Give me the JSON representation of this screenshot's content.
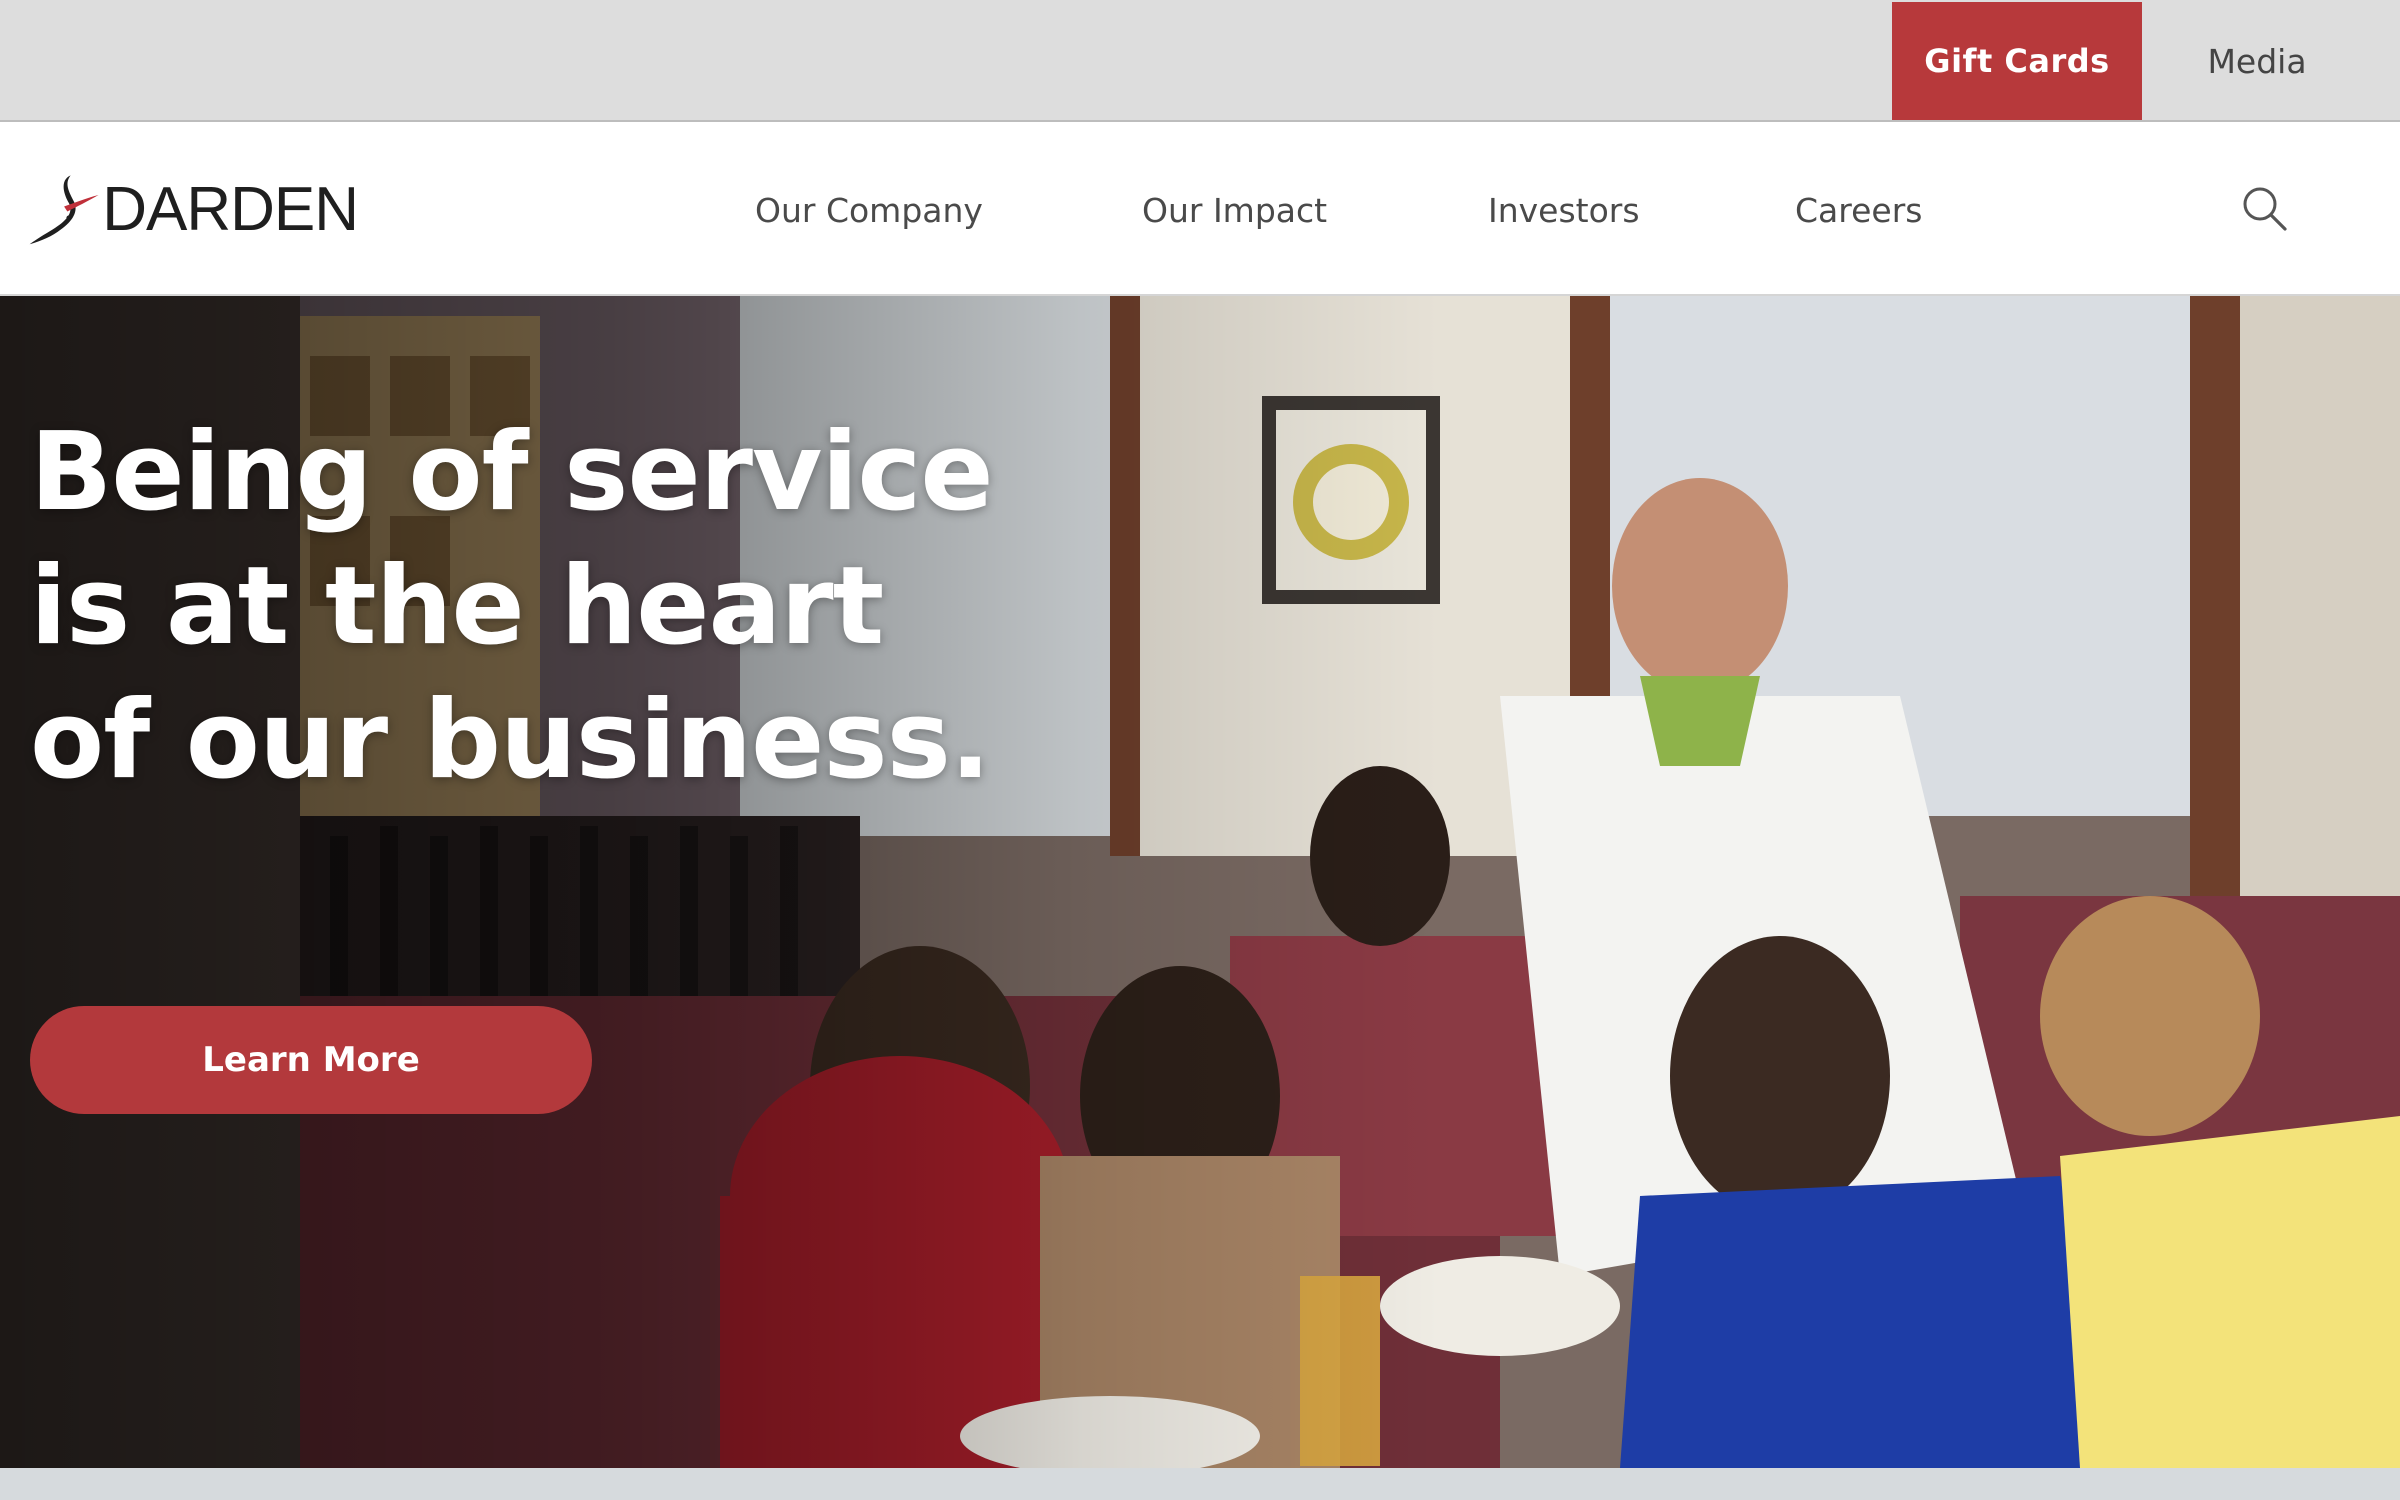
{
  "utility": {
    "gift_cards": "Gift Cards",
    "media": "Media"
  },
  "header": {
    "logo_text": "DARDEN",
    "nav": [
      "Our Company",
      "Our Impact",
      "Investors",
      "Careers"
    ]
  },
  "hero": {
    "headline": "Being of service is at the heart of our business.",
    "cta": "Learn More"
  },
  "icons": [
    "darden-logo-icon",
    "search-icon"
  ],
  "colors": {
    "accent": "#b7393b",
    "utility_bar": "#dddddd",
    "nav_text": "#4a4a4a"
  }
}
